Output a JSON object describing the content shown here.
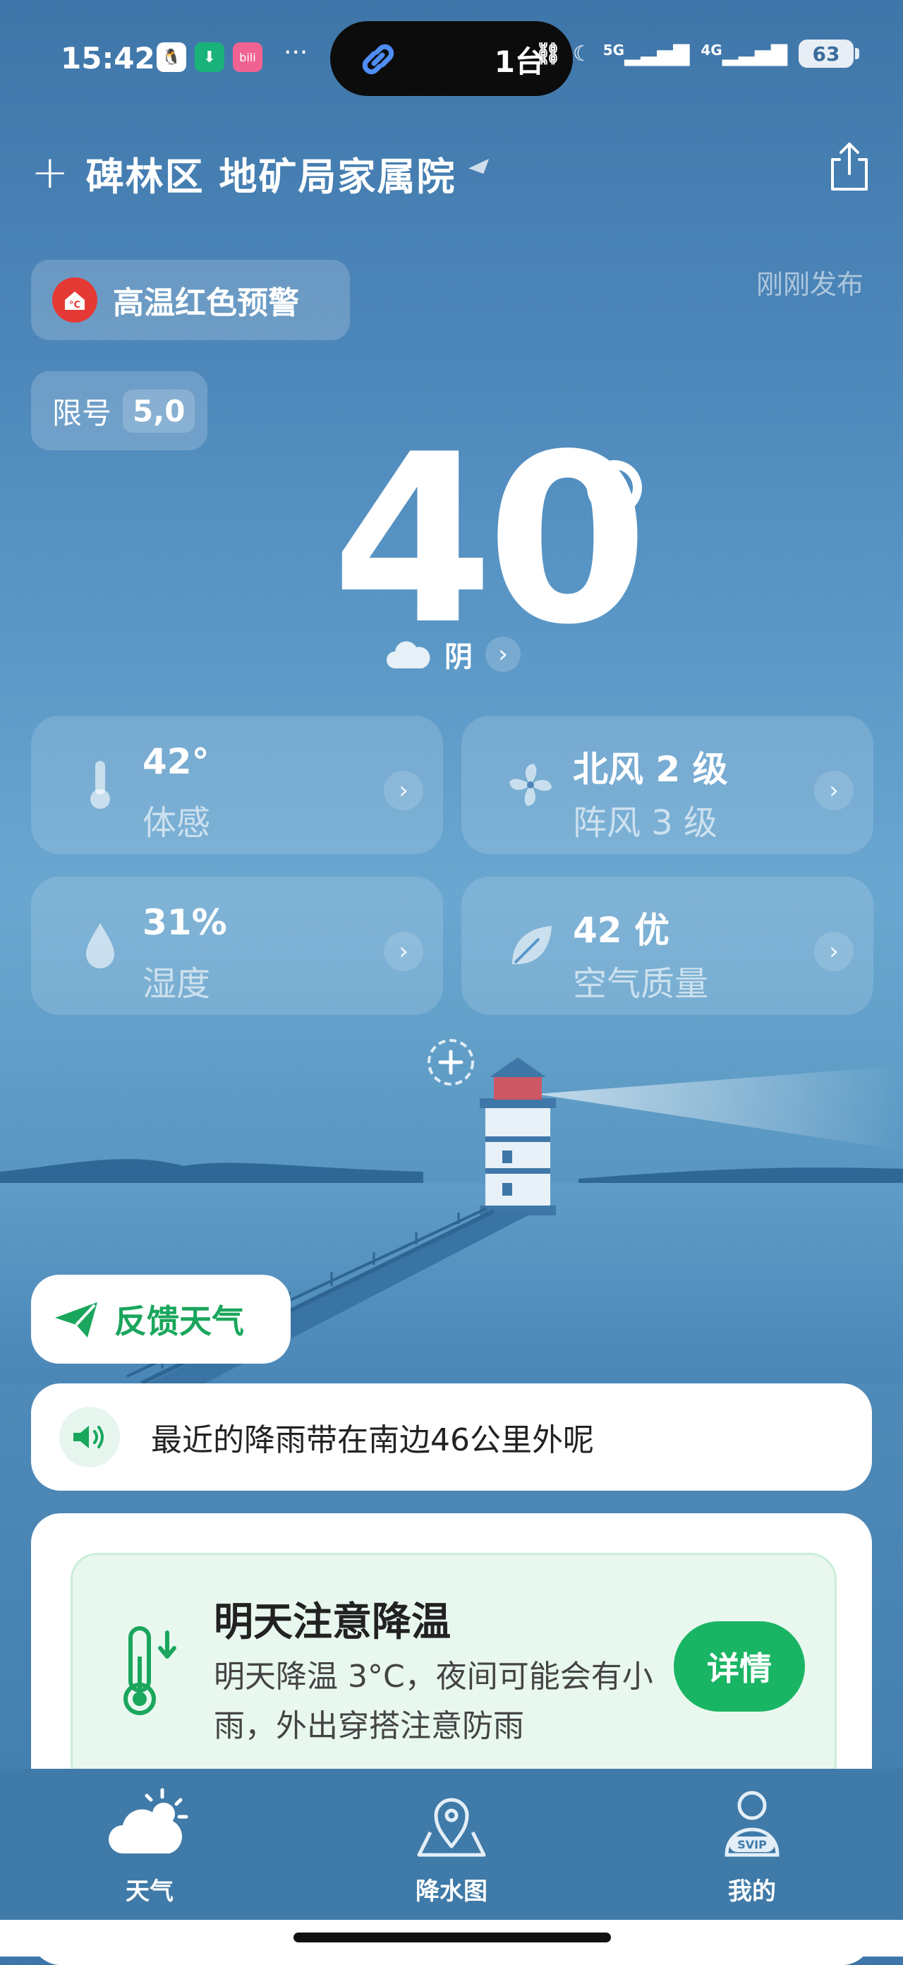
{
  "status_bar": {
    "time": "15:42",
    "island_count": "1台",
    "battery": "63",
    "net1": "5G",
    "net2": "4G",
    "app_icons": [
      "qq-icon",
      "download-icon",
      "bilibili-icon"
    ]
  },
  "header": {
    "location": "碑林区 地矿局家属院"
  },
  "warning": {
    "label": "高温红色预警",
    "published": "刚刚发布"
  },
  "restriction": {
    "label": "限号",
    "value": "5,0"
  },
  "current": {
    "temperature": "40",
    "condition": "阴"
  },
  "cards": [
    {
      "value": "42°",
      "label": "体感",
      "icon": "thermometer-icon"
    },
    {
      "value": "北风 2 级",
      "label": "阵风 3 级",
      "icon": "fan-icon"
    },
    {
      "value": "31%",
      "label": "湿度",
      "icon": "water-drop-icon"
    },
    {
      "value": "42 优",
      "label": "空气质量",
      "icon": "leaf-icon"
    }
  ],
  "feedback": {
    "label": "反馈天气"
  },
  "rain_notice": {
    "text": "最近的降雨带在南边46公里外呢"
  },
  "alert": {
    "title": "明天注意降温",
    "body": "明天降温 3°C，夜间可能会有小雨，外出穿搭注意防雨",
    "button": "详情"
  },
  "bottom_nav": [
    {
      "label": "天气",
      "icon": "weather-icon"
    },
    {
      "label": "降水图",
      "icon": "map-pin-icon"
    },
    {
      "label": "我的",
      "icon": "svip-user-icon"
    }
  ],
  "colors": {
    "sky": "#4d87ba",
    "accent_green": "#19b564",
    "warning_red": "#e53935"
  }
}
